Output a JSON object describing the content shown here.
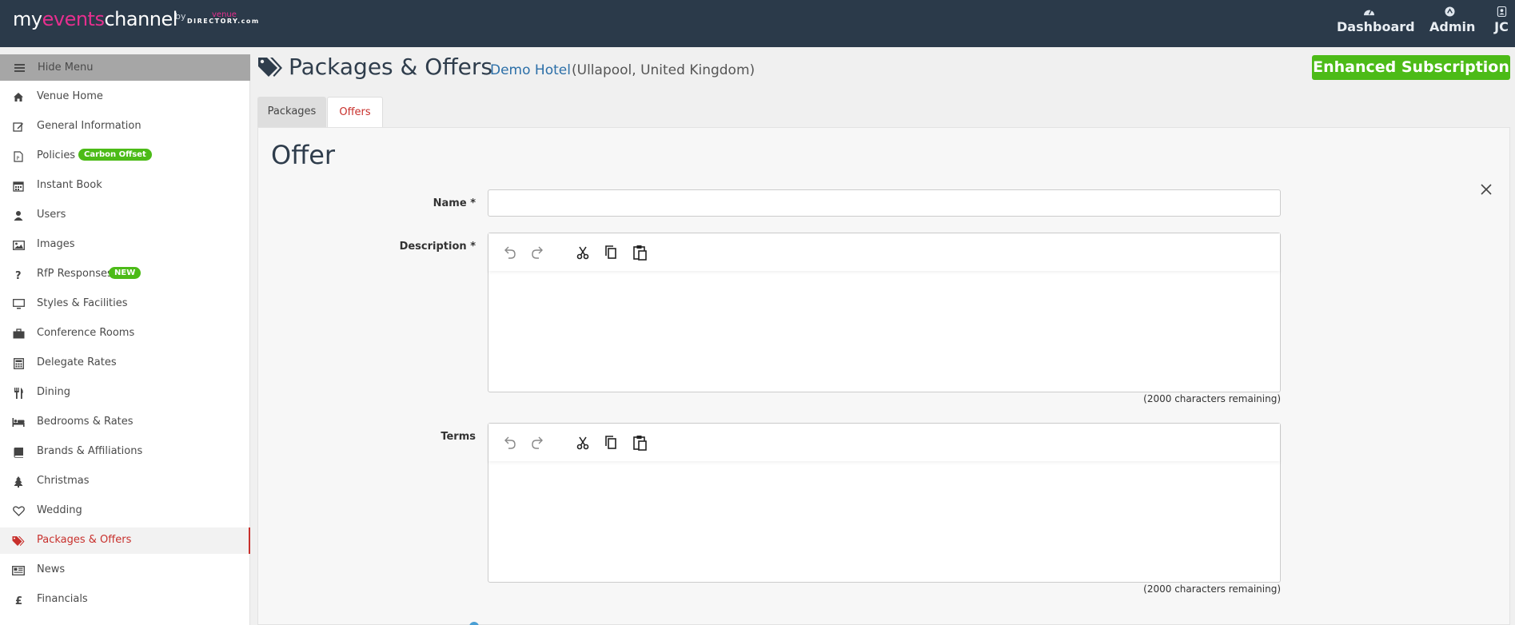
{
  "header": {
    "logo_part1": "my",
    "logo_part2": "events",
    "logo_part3": "channel",
    "logo_by": "by",
    "logo_venue": "venue",
    "logo_directory": "DIRECTORY.com",
    "nav": [
      {
        "label": "Dashboard",
        "icon": "dashboard-gauge-icon"
      },
      {
        "label": "Admin",
        "icon": "admin-icon"
      },
      {
        "label": "JC",
        "icon": "user-badge-icon"
      }
    ]
  },
  "sidebar": {
    "hide_menu": "Hide Menu",
    "items": [
      {
        "label": "Venue Home",
        "icon": "home-icon"
      },
      {
        "label": "General Information",
        "icon": "edit-icon"
      },
      {
        "label": "Policies",
        "icon": "document-icon",
        "badge": "Carbon Offset"
      },
      {
        "label": "Instant Book",
        "icon": "calendar-icon"
      },
      {
        "label": "Users",
        "icon": "user-icon"
      },
      {
        "label": "Images",
        "icon": "image-icon"
      },
      {
        "label": "RfP Responses",
        "icon": "question-icon",
        "badge": "NEW"
      },
      {
        "label": "Styles & Facilities",
        "icon": "monitor-icon"
      },
      {
        "label": "Conference Rooms",
        "icon": "briefcase-icon"
      },
      {
        "label": "Delegate Rates",
        "icon": "calculator-icon"
      },
      {
        "label": "Dining",
        "icon": "cutlery-icon"
      },
      {
        "label": "Bedrooms & Rates",
        "icon": "bed-icon"
      },
      {
        "label": "Brands & Affiliations",
        "icon": "book-icon"
      },
      {
        "label": "Christmas",
        "icon": "tree-icon"
      },
      {
        "label": "Wedding",
        "icon": "heart-icon"
      },
      {
        "label": "Packages & Offers",
        "icon": "tags-icon",
        "active": true
      },
      {
        "label": "News",
        "icon": "newspaper-icon"
      },
      {
        "label": "Financials",
        "icon": "pound-icon"
      }
    ]
  },
  "page": {
    "title": "Packages & Offers",
    "venue_name": "Demo Hotel",
    "venue_location": "(Ullapool, United Kingdom)",
    "subscription": "Enhanced Subscription",
    "tabs": [
      {
        "label": "Packages",
        "active": false
      },
      {
        "label": "Offers",
        "active": true
      }
    ]
  },
  "form": {
    "heading": "Offer",
    "name_label": "Name",
    "description_label": "Description",
    "terms_label": "Terms",
    "required_marker": "*",
    "name_value": "",
    "description_remaining": "(2000 characters remaining)",
    "terms_remaining": "(2000 characters remaining)",
    "toolbar": [
      "undo-icon",
      "redo-icon",
      "cut-icon",
      "copy-icon",
      "paste-icon"
    ]
  },
  "colors": {
    "topbar": "#2b3a4a",
    "accent_red": "#c8302c",
    "badge_green": "#4cbb17",
    "link_blue": "#2c6fa8"
  }
}
